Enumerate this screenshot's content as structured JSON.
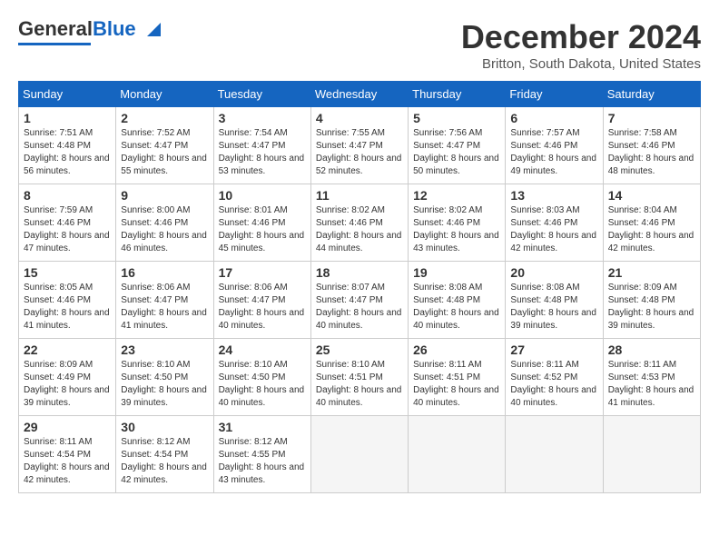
{
  "header": {
    "logo_line1": "General",
    "logo_line2": "Blue",
    "month": "December 2024",
    "location": "Britton, South Dakota, United States"
  },
  "days_of_week": [
    "Sunday",
    "Monday",
    "Tuesday",
    "Wednesday",
    "Thursday",
    "Friday",
    "Saturday"
  ],
  "weeks": [
    [
      {
        "day": "1",
        "sunrise": "7:51 AM",
        "sunset": "4:48 PM",
        "daylight": "8 hours and 56 minutes."
      },
      {
        "day": "2",
        "sunrise": "7:52 AM",
        "sunset": "4:47 PM",
        "daylight": "8 hours and 55 minutes."
      },
      {
        "day": "3",
        "sunrise": "7:54 AM",
        "sunset": "4:47 PM",
        "daylight": "8 hours and 53 minutes."
      },
      {
        "day": "4",
        "sunrise": "7:55 AM",
        "sunset": "4:47 PM",
        "daylight": "8 hours and 52 minutes."
      },
      {
        "day": "5",
        "sunrise": "7:56 AM",
        "sunset": "4:47 PM",
        "daylight": "8 hours and 50 minutes."
      },
      {
        "day": "6",
        "sunrise": "7:57 AM",
        "sunset": "4:46 PM",
        "daylight": "8 hours and 49 minutes."
      },
      {
        "day": "7",
        "sunrise": "7:58 AM",
        "sunset": "4:46 PM",
        "daylight": "8 hours and 48 minutes."
      }
    ],
    [
      {
        "day": "8",
        "sunrise": "7:59 AM",
        "sunset": "4:46 PM",
        "daylight": "8 hours and 47 minutes."
      },
      {
        "day": "9",
        "sunrise": "8:00 AM",
        "sunset": "4:46 PM",
        "daylight": "8 hours and 46 minutes."
      },
      {
        "day": "10",
        "sunrise": "8:01 AM",
        "sunset": "4:46 PM",
        "daylight": "8 hours and 45 minutes."
      },
      {
        "day": "11",
        "sunrise": "8:02 AM",
        "sunset": "4:46 PM",
        "daylight": "8 hours and 44 minutes."
      },
      {
        "day": "12",
        "sunrise": "8:02 AM",
        "sunset": "4:46 PM",
        "daylight": "8 hours and 43 minutes."
      },
      {
        "day": "13",
        "sunrise": "8:03 AM",
        "sunset": "4:46 PM",
        "daylight": "8 hours and 42 minutes."
      },
      {
        "day": "14",
        "sunrise": "8:04 AM",
        "sunset": "4:46 PM",
        "daylight": "8 hours and 42 minutes."
      }
    ],
    [
      {
        "day": "15",
        "sunrise": "8:05 AM",
        "sunset": "4:46 PM",
        "daylight": "8 hours and 41 minutes."
      },
      {
        "day": "16",
        "sunrise": "8:06 AM",
        "sunset": "4:47 PM",
        "daylight": "8 hours and 41 minutes."
      },
      {
        "day": "17",
        "sunrise": "8:06 AM",
        "sunset": "4:47 PM",
        "daylight": "8 hours and 40 minutes."
      },
      {
        "day": "18",
        "sunrise": "8:07 AM",
        "sunset": "4:47 PM",
        "daylight": "8 hours and 40 minutes."
      },
      {
        "day": "19",
        "sunrise": "8:08 AM",
        "sunset": "4:48 PM",
        "daylight": "8 hours and 40 minutes."
      },
      {
        "day": "20",
        "sunrise": "8:08 AM",
        "sunset": "4:48 PM",
        "daylight": "8 hours and 39 minutes."
      },
      {
        "day": "21",
        "sunrise": "8:09 AM",
        "sunset": "4:48 PM",
        "daylight": "8 hours and 39 minutes."
      }
    ],
    [
      {
        "day": "22",
        "sunrise": "8:09 AM",
        "sunset": "4:49 PM",
        "daylight": "8 hours and 39 minutes."
      },
      {
        "day": "23",
        "sunrise": "8:10 AM",
        "sunset": "4:50 PM",
        "daylight": "8 hours and 39 minutes."
      },
      {
        "day": "24",
        "sunrise": "8:10 AM",
        "sunset": "4:50 PM",
        "daylight": "8 hours and 40 minutes."
      },
      {
        "day": "25",
        "sunrise": "8:10 AM",
        "sunset": "4:51 PM",
        "daylight": "8 hours and 40 minutes."
      },
      {
        "day": "26",
        "sunrise": "8:11 AM",
        "sunset": "4:51 PM",
        "daylight": "8 hours and 40 minutes."
      },
      {
        "day": "27",
        "sunrise": "8:11 AM",
        "sunset": "4:52 PM",
        "daylight": "8 hours and 40 minutes."
      },
      {
        "day": "28",
        "sunrise": "8:11 AM",
        "sunset": "4:53 PM",
        "daylight": "8 hours and 41 minutes."
      }
    ],
    [
      {
        "day": "29",
        "sunrise": "8:11 AM",
        "sunset": "4:54 PM",
        "daylight": "8 hours and 42 minutes."
      },
      {
        "day": "30",
        "sunrise": "8:12 AM",
        "sunset": "4:54 PM",
        "daylight": "8 hours and 42 minutes."
      },
      {
        "day": "31",
        "sunrise": "8:12 AM",
        "sunset": "4:55 PM",
        "daylight": "8 hours and 43 minutes."
      },
      null,
      null,
      null,
      null
    ]
  ]
}
